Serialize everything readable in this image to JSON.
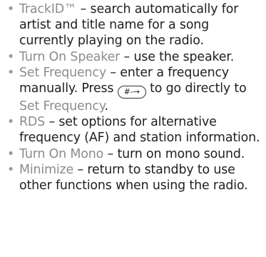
{
  "options": [
    {
      "term": "TrackID™",
      "sep": " – ",
      "desc": "search automatically for artist and title name for a song currently playing on the radio."
    },
    {
      "term": "Turn On Speaker",
      "sep": " – ",
      "desc": "use the speaker."
    },
    {
      "term": "Set Frequency",
      "sep": " – ",
      "desc_before_key": "enter a frequency manually. Press ",
      "key": "#-→",
      "desc_after_key": " to go directly to ",
      "link": "Set Frequency",
      "end": "."
    },
    {
      "term": "RDS",
      "sep": " – ",
      "desc": "set options for alternative frequency (AF) and station information."
    },
    {
      "term": "Turn On Mono",
      "sep": " – ",
      "desc": "turn on mono sound."
    },
    {
      "term": "Minimize",
      "sep": " – ",
      "desc": "return to standby to use other functions when using the radio."
    }
  ],
  "bullet": "•"
}
